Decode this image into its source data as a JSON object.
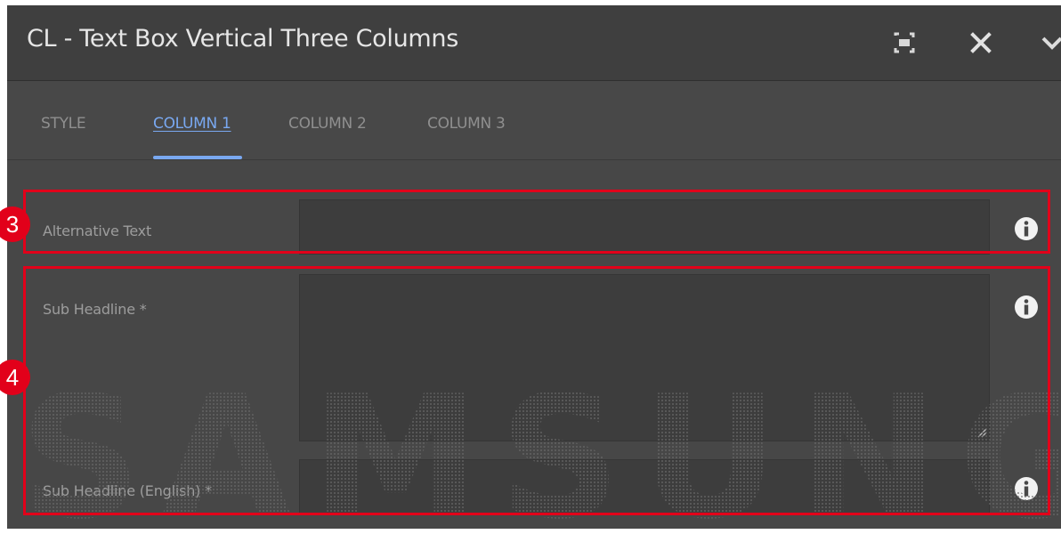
{
  "dialog": {
    "title": "CL - Text Box Vertical Three Columns"
  },
  "header_buttons": {
    "fullscreen_icon": "fullscreen-icon",
    "close_icon": "close-icon",
    "done_icon": "chevron-down-icon"
  },
  "tabs": [
    {
      "label": "STYLE",
      "active": false
    },
    {
      "label": "COLUMN 1",
      "active": true
    },
    {
      "label": "COLUMN 2",
      "active": false
    },
    {
      "label": "COLUMN 3",
      "active": false
    }
  ],
  "fields": {
    "alternative_text": {
      "label": "Alternative Text",
      "value": ""
    },
    "sub_headline": {
      "label": "Sub Headline *",
      "value": ""
    },
    "sub_headline_english": {
      "label": "Sub Headline (English) *",
      "value": ""
    }
  },
  "annotations": {
    "marker_3": "3",
    "marker_4": "4"
  },
  "watermark": {
    "text": "SAMSUNG"
  },
  "colors": {
    "accent": "#79a8f0",
    "highlight": "#e2001a",
    "background": "#474747",
    "titlebar": "#3f3f3f"
  }
}
